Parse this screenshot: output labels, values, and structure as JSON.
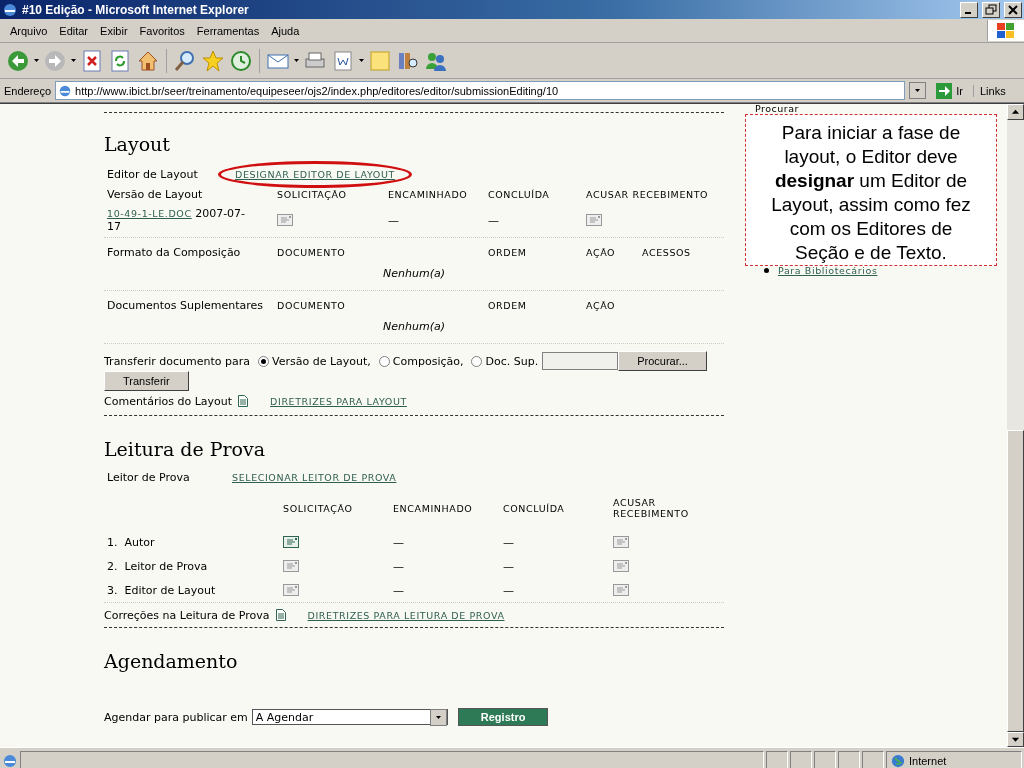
{
  "window": {
    "title": "#10 Edição - Microsoft Internet Explorer"
  },
  "menu": [
    "Arquivo",
    "Editar",
    "Exibir",
    "Favoritos",
    "Ferramentas",
    "Ajuda"
  ],
  "address": {
    "label": "Endereço",
    "url": "http://www.ibict.br/seer/treinamento/equipeseer/ojs2/index.php/editores/editor/submissionEditing/10",
    "go": "Ir",
    "links": "Links"
  },
  "layout": {
    "heading": "Layout",
    "editor_label": "Editor de Layout",
    "editor_link": "DESIGNAR EDITOR DE LAYOUT",
    "version_label": "Versão de Layout",
    "columns": [
      "SOLICITAÇÃO",
      "ENCAMINHADO",
      "CONCLUÍDA",
      "ACUSAR RECEBIMENTO"
    ],
    "file": {
      "link": "10-49-1-LE.DOC",
      "date": "2007-07-17",
      "request_active": false,
      "underway": "—",
      "completed": "—",
      "ack_active": false
    },
    "formats": {
      "label": "Formato da Composição",
      "columns": [
        "DOCUMENTO",
        "ORDEM",
        "AÇÃO",
        "ACESSOS"
      ],
      "empty": "Nenhum(a)"
    },
    "supplementary": {
      "label": "Documentos Suplementares",
      "columns": [
        "DOCUMENTO",
        "ORDEM",
        "AÇÃO"
      ],
      "empty": "Nenhum(a)"
    },
    "upload": {
      "label": "Transferir documento para",
      "options": [
        {
          "label": "Versão de Layout,",
          "selected": true
        },
        {
          "label": "Composição,",
          "selected": false
        },
        {
          "label": "Doc. Sup.",
          "selected": false
        }
      ],
      "browse": "Procurar...",
      "submit": "Transferir"
    },
    "comments_label": "Comentários do Layout",
    "guidelines_link": "DIRETRIZES PARA LAYOUT"
  },
  "proofreading": {
    "heading": "Leitura de Prova",
    "reader_label": "Leitor de Prova",
    "reader_link": "SELECIONAR LEITOR DE PROVA",
    "columns": [
      "SOLICITAÇÃO",
      "ENCAMINHADO",
      "CONCLUÍDA",
      "ACUSAR RECEBIMENTO"
    ],
    "rows": [
      {
        "number": "1.",
        "name": "Autor",
        "request_active": true,
        "underway": "—",
        "completed": "—",
        "ack_active": false
      },
      {
        "number": "2.",
        "name": "Leitor de Prova",
        "request_active": false,
        "underway": "—",
        "completed": "—",
        "ack_active": false
      },
      {
        "number": "3.",
        "name": "Editor de Layout",
        "request_active": false,
        "underway": "—",
        "completed": "—",
        "ack_active": false
      }
    ],
    "corrections_label": "Correções na Leitura de Prova",
    "guidelines_link": "DIRETRIZES PARA LEITURA DE PROVA"
  },
  "scheduling": {
    "heading": "Agendamento",
    "label": "Agendar para publicar em",
    "select_value": "A Agendar",
    "button": "Registro"
  },
  "sidebar": {
    "search_label": "Procurar",
    "librarians_link": "Para Bibliotecários"
  },
  "callout": "Para iniciar a fase de layout, o Editor deve **designar** um Editor de Layout, assim como fez com os Editores de Seção e de Texto.",
  "status_bar": {
    "zone": "Internet"
  }
}
